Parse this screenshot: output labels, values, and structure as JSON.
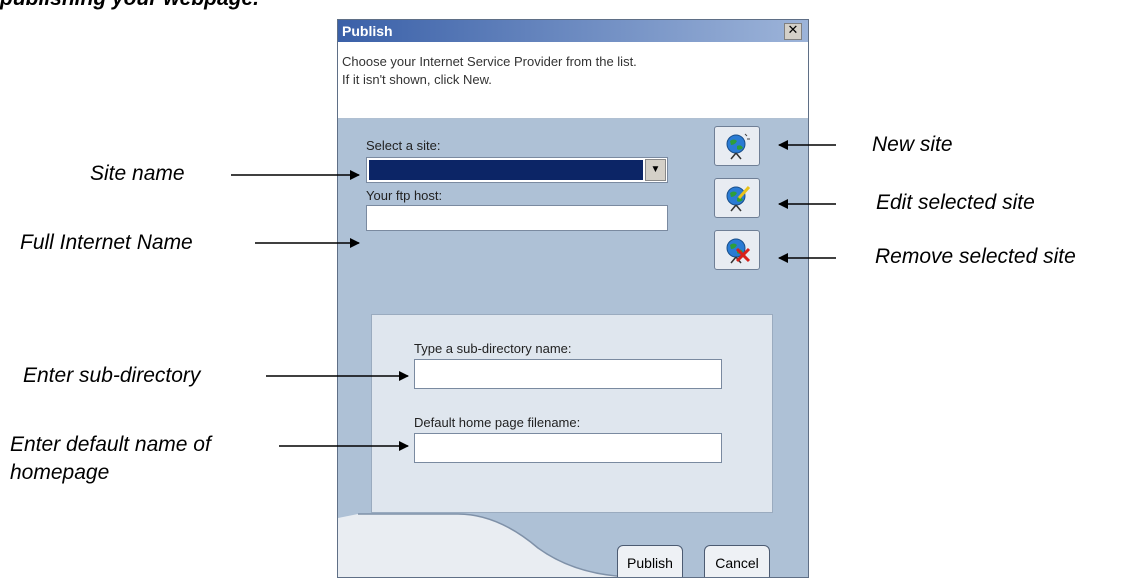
{
  "document": {
    "heading": "publishing your webpage."
  },
  "dialog": {
    "title": "Publish",
    "close_icon": "close-icon",
    "info_lines": [
      "Choose your Internet Service Provider from the list.",
      "If it isn't shown, click New."
    ],
    "select_site_label": "Select a site:",
    "select_site_value": "",
    "ftp_host_label": "Your ftp host:",
    "ftp_host_value": "",
    "subdir_label": "Type a sub-directory name:",
    "subdir_value": "",
    "homepage_label": "Default home page filename:",
    "homepage_value": "",
    "icons": {
      "new": "globe-new-site-icon",
      "edit": "globe-edit-site-icon",
      "remove": "globe-remove-site-icon"
    },
    "publish_label": "Publish",
    "cancel_label": "Cancel"
  },
  "annotations": {
    "site_name": "Site name",
    "full_internet_name": "Full Internet Name",
    "enter_subdir": "Enter sub-directory",
    "default_name_line1": "Enter default name of",
    "default_name_line2": "homepage",
    "new_site": "New site",
    "edit_site": "Edit selected site",
    "remove_site": "Remove selected site"
  },
  "colors": {
    "titlebar": "#3a60a8",
    "dialog_bg": "#aec1d6",
    "selection": "#0c2566"
  }
}
